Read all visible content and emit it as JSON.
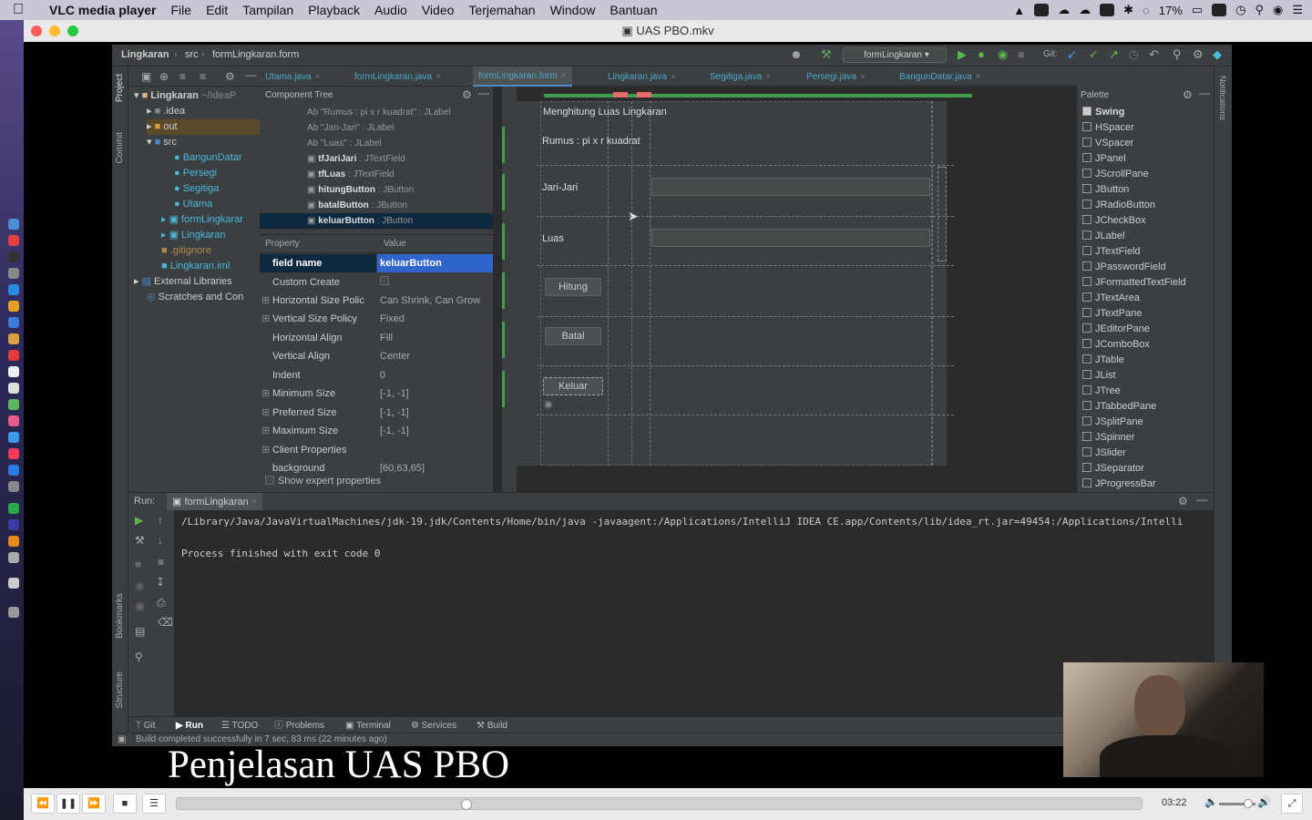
{
  "menubar": {
    "app_name": "VLC media player",
    "items": [
      "File",
      "Edit",
      "Tampilan",
      "Playback",
      "Audio",
      "Video",
      "Terjemahan",
      "Window",
      "Bantuan"
    ],
    "battery": "17%"
  },
  "window": {
    "title": "UAS PBO.mkv"
  },
  "ide": {
    "breadcrumb": [
      "Lingkaran",
      "src",
      "formLingkaran.form"
    ],
    "run_config": "formLingkaran",
    "git_label": "Git:",
    "tabs": [
      "Utama.java",
      "formLingkaran.java",
      "formLingkaran.form",
      "Lingkaran.java",
      "Segitiga.java",
      "Persegi.java",
      "BangunDatar.java"
    ],
    "active_tab": "formLingkaran.form",
    "project_tree": {
      "root": "Lingkaran",
      "root_path": "~/IdeaP",
      "items": [
        {
          "label": ".idea",
          "type": "folder"
        },
        {
          "label": "out",
          "type": "folder"
        },
        {
          "label": "src",
          "type": "folder"
        },
        {
          "label": "BangunDatar",
          "type": "class"
        },
        {
          "label": "Persegi",
          "type": "class"
        },
        {
          "label": "Segitiga",
          "type": "class"
        },
        {
          "label": "Utama",
          "type": "class"
        },
        {
          "label": "formLingkarar",
          "type": "form"
        },
        {
          "label": "Lingkaran",
          "type": "form"
        },
        {
          "label": ".gitignore",
          "type": "file"
        },
        {
          "label": "Lingkaran.iml",
          "type": "file"
        },
        {
          "label": "External Libraries",
          "type": "lib"
        },
        {
          "label": "Scratches and Con",
          "type": "lib"
        }
      ]
    },
    "component_tree": {
      "title": "Component Tree",
      "items": [
        {
          "name": "Ab \"Rumus : pi x r kuadrat\"",
          "type": ": JLabel"
        },
        {
          "name": "Ab \"Jari-Jari\"",
          "type": ": JLabel"
        },
        {
          "name": "Ab \"Luas\"",
          "type": ": JLabel"
        },
        {
          "name": "tfJariJari",
          "type": ": JTextField"
        },
        {
          "name": "tfLuas",
          "type": ": JTextField"
        },
        {
          "name": "hitungButton",
          "type": ": JButton"
        },
        {
          "name": "batalButton",
          "type": ": JButton"
        },
        {
          "name": "keluarButton",
          "type": ": JButton"
        }
      ]
    },
    "properties": {
      "header_property": "Property",
      "header_value": "Value",
      "rows": [
        {
          "key": "field name",
          "value": "keluarButton"
        },
        {
          "key": "Custom Create",
          "value": ""
        },
        {
          "key": "Horizontal Size Polic",
          "value": "Can Shrink, Can Grow"
        },
        {
          "key": "Vertical Size Policy",
          "value": "Fixed"
        },
        {
          "key": "Horizontal Align",
          "value": "Fill"
        },
        {
          "key": "Vertical Align",
          "value": "Center"
        },
        {
          "key": "Indent",
          "value": "0"
        },
        {
          "key": "Minimum Size",
          "value": "[-1, -1]"
        },
        {
          "key": "Preferred Size",
          "value": "[-1, -1]"
        },
        {
          "key": "Maximum Size",
          "value": "[-1, -1]"
        },
        {
          "key": "Client Properties",
          "value": ""
        },
        {
          "key": "background",
          "value": "[60,63,65]"
        }
      ],
      "show_expert": "Show expert properties"
    },
    "form": {
      "title": "Menghitung Luas Lingkaran",
      "rumus": "Rumus : pi x r kuadrat",
      "label_jari": "Jari-Jari",
      "label_luas": "Luas",
      "btn_hitung": "Hitung",
      "btn_batal": "Batal",
      "btn_keluar": "Keluar"
    },
    "palette": {
      "title": "Palette",
      "group": "Swing",
      "items": [
        "HSpacer",
        "VSpacer",
        "JPanel",
        "JScrollPane",
        "JButton",
        "JRadioButton",
        "JCheckBox",
        "JLabel",
        "JTextField",
        "JPasswordField",
        "JFormattedTextField",
        "JTextArea",
        "JTextPane",
        "JEditorPane",
        "JComboBox",
        "JTable",
        "JList",
        "JTree",
        "JTabbedPane",
        "JSplitPane",
        "JSpinner",
        "JSlider",
        "JSeparator",
        "JProgressBar"
      ]
    },
    "side_labels": {
      "project": "Project",
      "commit": "Commit",
      "bookmarks": "Bookmarks",
      "structure": "Structure",
      "notifications": "Notifications"
    },
    "run": {
      "label": "Run:",
      "config": "formLingkaran",
      "command": "/Library/Java/JavaVirtualMachines/jdk-19.jdk/Contents/Home/bin/java -javaagent:/Applications/IntelliJ IDEA CE.app/Contents/lib/idea_rt.jar=49454:/Applications/Intelli",
      "exit": "Process finished with exit code 0"
    },
    "bottom_tabs": [
      "Git",
      "Run",
      "TODO",
      "Problems",
      "Terminal",
      "Services",
      "Build"
    ],
    "status": "Build completed successfully in 7 sec, 83 ms (22 minutes ago)"
  },
  "subtitle": "Penjelasan UAS PBO",
  "player": {
    "time": "03:22",
    "progress": 0.3,
    "volume": 0.8
  }
}
